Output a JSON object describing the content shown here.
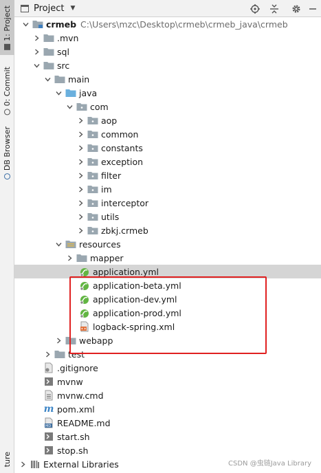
{
  "tool_strip": {
    "project_tab": "1: Project",
    "commit_tab": "0: Commit",
    "db_tab": "DB Browser",
    "structure_tab": "ture"
  },
  "header": {
    "view_label": "Project",
    "icons": [
      "target-icon",
      "collapse-all-icon",
      "settings-gear-icon",
      "minimize-icon"
    ]
  },
  "tree": {
    "root": {
      "name": "crmeb",
      "path": "C:\\Users\\mzc\\Desktop\\crmeb\\crmeb_java\\crmeb"
    },
    "mvn": ".mvn",
    "sql": "sql",
    "src": "src",
    "main": "main",
    "java": "java",
    "com": "com",
    "packages": [
      "aop",
      "common",
      "constants",
      "exception",
      "filter",
      "im",
      "interceptor",
      "utils",
      "zbkj.crmeb"
    ],
    "resources": "resources",
    "mapper": "mapper",
    "resource_files": [
      "application.yml",
      "application-beta.yml",
      "application-dev.yml",
      "application-prod.yml",
      "logback-spring.xml"
    ],
    "webapp": "webapp",
    "test": "test",
    "root_files": [
      ".gitignore",
      "mvnw",
      "mvnw.cmd",
      "pom.xml",
      "README.md",
      "start.sh",
      "stop.sh"
    ],
    "external_libraries": "External Libraries"
  },
  "watermark": "CSDN @虫链Java Library",
  "colors": {
    "highlight": "#e02020",
    "selected_row": "#d5d5d5",
    "folder": "#9aa7b0",
    "source_folder": "#6ab0de",
    "yaml_leaf": "#62b543"
  }
}
